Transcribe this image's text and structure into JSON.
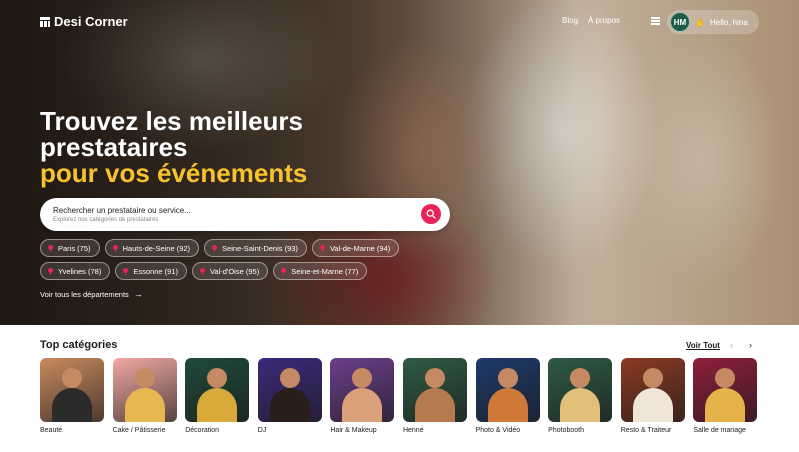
{
  "nav": {
    "logo_text": "Desi Corner",
    "links": [
      "Blog",
      "À propos"
    ],
    "user": {
      "initials": "HM",
      "greeting": "Hello, hina"
    }
  },
  "hero": {
    "headline_line1": "Trouvez les meilleurs",
    "headline_line2": "prestataires",
    "headline_accent": "pour vos événements",
    "search": {
      "placeholder": "Rechercher un prestataire ou service...",
      "subtitle": "Explorez nos catégories de prestataires"
    },
    "locations_row1": [
      "Paris (75)",
      "Hauts-de-Seine (92)",
      "Seine-Saint-Denis (93)",
      "Val-de-Marne (94)"
    ],
    "locations_row2": [
      "Yvelines (78)",
      "Essonne (91)",
      "Val-d'Oise (95)",
      "Seine-et-Marne (77)"
    ],
    "all_departments": "Voir tous les départements"
  },
  "categories": {
    "title": "Top catégories",
    "see_all": "Voir Tout",
    "items": [
      {
        "label": "Beauté",
        "bg": "#c98a5e",
        "fg": "#2b2b2b"
      },
      {
        "label": "Cake / Pâtisserie",
        "bg": "#f1a9a3",
        "fg": "#e7b84f"
      },
      {
        "label": "Décoration",
        "bg": "#1f4a3a",
        "fg": "#d9a93a"
      },
      {
        "label": "DJ",
        "bg": "#3b2a7a",
        "fg": "#2a1d1a"
      },
      {
        "label": "Hair & Makeup",
        "bg": "#6b3f8a",
        "fg": "#d9a07a"
      },
      {
        "label": "Henné",
        "bg": "#2f5b43",
        "fg": "#b57a4e"
      },
      {
        "label": "Photo & Vidéo",
        "bg": "#1e3a6a",
        "fg": "#d07a3a"
      },
      {
        "label": "Photobooth",
        "bg": "#2e5a44",
        "fg": "#e3c07a"
      },
      {
        "label": "Resto & Traiteur",
        "bg": "#8a3a22",
        "fg": "#f0e6d8"
      },
      {
        "label": "Salle de mariage",
        "bg": "#8e1f3a",
        "fg": "#e8b24a"
      }
    ]
  },
  "colors": {
    "accent_yellow": "#f7c22e",
    "accent_pink": "#e6245a",
    "avatar_green": "#1f5b46"
  }
}
